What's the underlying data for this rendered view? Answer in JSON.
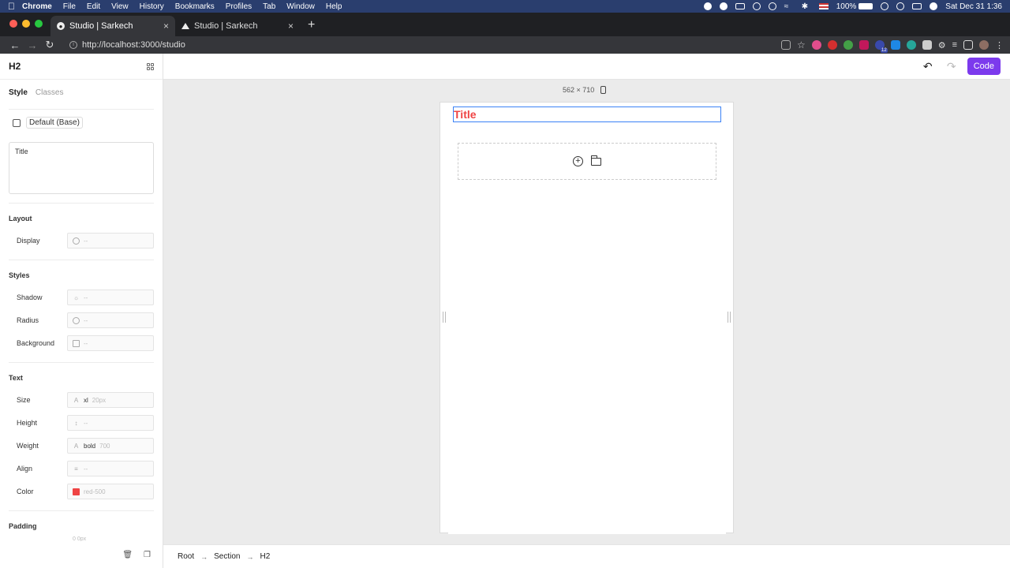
{
  "menubar": {
    "app": "Chrome",
    "items": [
      "File",
      "Edit",
      "View",
      "History",
      "Bookmarks",
      "Profiles",
      "Tab",
      "Window",
      "Help"
    ],
    "battery": "100%",
    "datetime": "Sat Dec 31  1:36"
  },
  "tabs": [
    {
      "title": "Studio | Sarkech",
      "active": true
    },
    {
      "title": "Studio | Sarkech",
      "active": false
    }
  ],
  "address": {
    "url": "http://localhost:3000/studio",
    "ext_badge": "12"
  },
  "toolbar": {
    "code_label": "Code"
  },
  "sidebar": {
    "title": "H2",
    "tabs": [
      "Style",
      "Classes"
    ],
    "state_label": "Default (Base)",
    "text_value": "Title",
    "sections": {
      "layout": "Layout",
      "styles": "Styles",
      "text": "Text",
      "padding": "Padding"
    },
    "props": {
      "display": {
        "label": "Display",
        "value": "",
        "hint": "--"
      },
      "shadow": {
        "label": "Shadow",
        "value": "",
        "hint": "--"
      },
      "radius": {
        "label": "Radius",
        "value": "",
        "hint": "--"
      },
      "background": {
        "label": "Background",
        "value": "",
        "hint": "--"
      },
      "size": {
        "label": "Size",
        "value": "xl",
        "hint": "20px"
      },
      "height": {
        "label": "Height",
        "value": "",
        "hint": "--"
      },
      "weight": {
        "label": "Weight",
        "value": "bold",
        "hint": "700"
      },
      "align": {
        "label": "Align",
        "value": "",
        "hint": "--"
      },
      "color": {
        "label": "Color",
        "value": "",
        "hint": "red-500"
      }
    },
    "padding_hint": "0 0px"
  },
  "canvas": {
    "size_label": "562 × 710",
    "heading_text": "Title"
  },
  "breadcrumb": [
    "Root",
    "Section",
    "H2"
  ],
  "colors": {
    "accent": "#7c3aed",
    "selection": "#3b82f6",
    "text_red": "#ef4444"
  }
}
